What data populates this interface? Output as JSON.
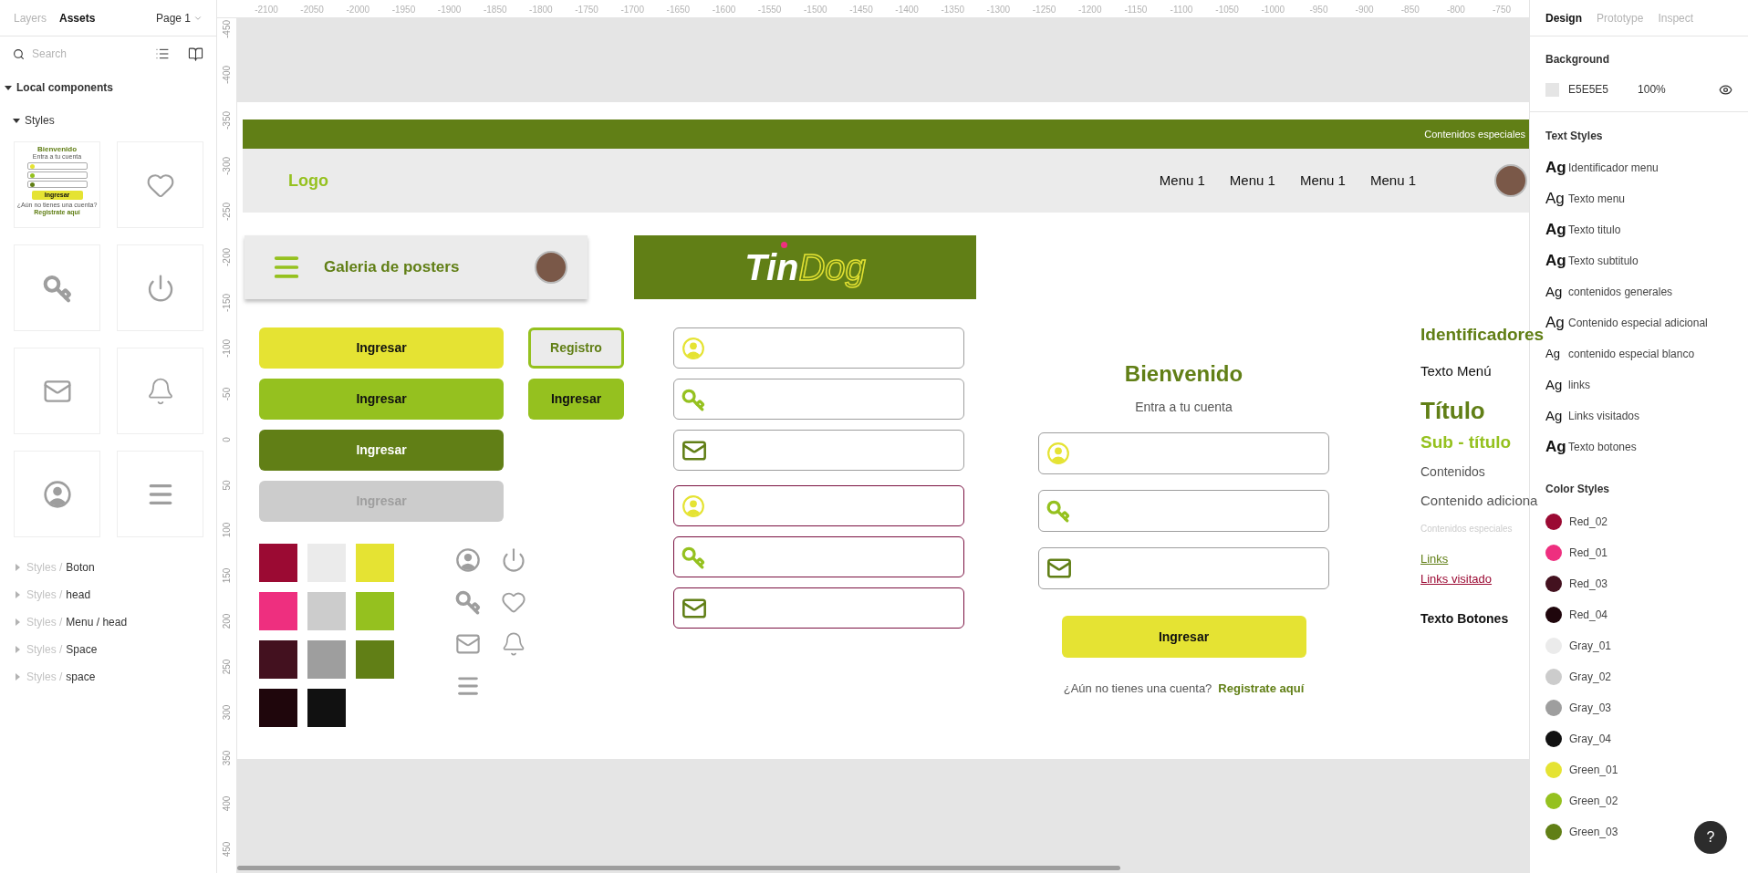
{
  "left_panel": {
    "tabs": [
      {
        "label": "Layers",
        "selected": false
      },
      {
        "label": "Assets",
        "selected": true
      }
    ],
    "page": "Page 1",
    "search": {
      "placeholder": "Search"
    },
    "section": {
      "label": "Local components",
      "expanded": true
    },
    "group": {
      "label": "Styles",
      "expanded": true
    },
    "thumbnail": {
      "title": "Bienvenido",
      "subtitle": "Entra a tu cuenta",
      "button": "Ingresar",
      "prompt": "¿Aún no tienes una cuenta?",
      "link": "Registrate aquí"
    },
    "tree": [
      {
        "prefix": "Styles /",
        "label": "Boton",
        "expanded": false
      },
      {
        "prefix": "Styles /",
        "label": "head",
        "expanded": false
      },
      {
        "prefix": "Styles /",
        "label": "Menu / head",
        "expanded": false
      },
      {
        "prefix": "Styles /",
        "label": "Space",
        "expanded": false
      },
      {
        "prefix": "Styles /",
        "label": "space",
        "expanded": false
      }
    ]
  },
  "rulers": {
    "horizontal": [
      "-2100",
      "-2050",
      "-2000",
      "-1950",
      "-1900",
      "-1850",
      "-1800",
      "-1750",
      "-1700",
      "-1650",
      "-1600",
      "-1550",
      "-1500",
      "-1450",
      "-1400",
      "-1350",
      "-1300",
      "-1250",
      "-1200",
      "-1150",
      "-1100",
      "-1050",
      "-1000",
      "-950",
      "-900",
      "-850",
      "-800",
      "-750"
    ],
    "vertical": [
      "-450",
      "-400",
      "-350",
      "-300",
      "-250",
      "-200",
      "-150",
      "-100",
      "-50",
      "0",
      "50",
      "100",
      "150",
      "200",
      "250",
      "300",
      "350",
      "400",
      "450"
    ]
  },
  "canvas": {
    "banner": {
      "text": "Contenidos especiales"
    },
    "header": {
      "logo": "Logo",
      "menu": [
        "Menu 1",
        "Menu 1",
        "Menu 1",
        "Menu 1"
      ]
    },
    "app_bar": {
      "title": "Galeria de posters"
    },
    "brand": {
      "solid": "Tin",
      "outline": "Dog"
    },
    "buttons": [
      {
        "label": "Ingresar",
        "kind": "primary"
      },
      {
        "label": "Ingresar",
        "kind": "secondary"
      },
      {
        "label": "Ingresar",
        "kind": "dark"
      },
      {
        "label": "Ingresar",
        "kind": "disabled"
      }
    ],
    "side_buttons": [
      {
        "label": "Registro",
        "kind": "outline"
      },
      {
        "label": "Ingresar",
        "kind": "secondary"
      }
    ],
    "swatches": [
      {
        "color": "#9b0a33"
      },
      {
        "color": "#ebebeb"
      },
      {
        "color": "#e5e333"
      },
      {
        "color": "#ee2f7f"
      },
      {
        "color": "#cccccc"
      },
      {
        "color": "#95c11f"
      },
      {
        "color": "#43111f"
      },
      {
        "color": "#9e9e9e"
      },
      {
        "color": "#617f16"
      },
      {
        "color": "#1f060c"
      },
      {
        "color": "#111111"
      }
    ],
    "inputs": [
      {
        "kind": "default"
      },
      {
        "kind": "default"
      },
      {
        "kind": "default"
      },
      {
        "kind": "error"
      },
      {
        "kind": "error"
      },
      {
        "kind": "error"
      }
    ],
    "login": {
      "title": "Bienvenido",
      "subtitle": "Entra a tu cuenta",
      "fields": [
        {
          "kind": "default"
        },
        {
          "kind": "default"
        },
        {
          "kind": "default"
        }
      ],
      "button": "Ingresar",
      "prompt": "¿Aún no tienes una cuenta?",
      "link": "Registrate aquí"
    },
    "type_samples": [
      {
        "text": "Identificadores",
        "kind": "identifier"
      },
      {
        "text": "Texto Menú",
        "kind": "menu"
      },
      {
        "text": "Título",
        "kind": "title"
      },
      {
        "text": "Sub - título",
        "kind": "subtitle"
      },
      {
        "text": "Contenidos",
        "kind": "content"
      },
      {
        "text": "Contenido adiciona",
        "kind": "extra"
      },
      {
        "text": "Contenidos especiales",
        "kind": "special"
      },
      {
        "text": "Links",
        "kind": "link"
      },
      {
        "text": "Links visitado",
        "kind": "visited"
      },
      {
        "text": "Texto Botones",
        "kind": "button"
      }
    ]
  },
  "right_panel": {
    "tabs": [
      {
        "label": "Design",
        "selected": true
      },
      {
        "label": "Prototype",
        "selected": false
      },
      {
        "label": "Inspect",
        "selected": false
      }
    ],
    "background": {
      "label": "Background",
      "hex": "E5E5E5",
      "opacity": "100%",
      "visible": true,
      "color": "#e5e5e5"
    },
    "text_styles": {
      "title": "Text Styles",
      "items": [
        {
          "sample": "Ag",
          "name": "Identificador menu",
          "kind": "bold"
        },
        {
          "sample": "Ag",
          "name": "Texto menu",
          "kind": "regular"
        },
        {
          "sample": "Ag",
          "name": "Texto titulo",
          "kind": "bold"
        },
        {
          "sample": "Ag",
          "name": "Texto subtitulo",
          "kind": "bold"
        },
        {
          "sample": "Ag",
          "name": "contenidos generales",
          "kind": "medium"
        },
        {
          "sample": "Ag",
          "name": "Contenido especial adicional",
          "kind": "regular"
        },
        {
          "sample": "Ag",
          "name": "contenido especial blanco",
          "kind": "small"
        },
        {
          "sample": "Ag",
          "name": "links",
          "kind": "medium"
        },
        {
          "sample": "Ag",
          "name": "Links visitados",
          "kind": "medium"
        },
        {
          "sample": "Ag",
          "name": "Texto botones",
          "kind": "bold"
        }
      ]
    },
    "color_styles": {
      "title": "Color Styles",
      "items": [
        {
          "name": "Red_02",
          "color": "#9b0a33"
        },
        {
          "name": "Red_01",
          "color": "#ee2f7f"
        },
        {
          "name": "Red_03",
          "color": "#43111f"
        },
        {
          "name": "Red_04",
          "color": "#1f060c"
        },
        {
          "name": "Gray_01",
          "color": "#ebebeb"
        },
        {
          "name": "Gray_02",
          "color": "#cccccc"
        },
        {
          "name": "Gray_03",
          "color": "#9e9e9e"
        },
        {
          "name": "Gray_04",
          "color": "#111111"
        },
        {
          "name": "Green_01",
          "color": "#e5e333"
        },
        {
          "name": "Green_02",
          "color": "#95c11f"
        },
        {
          "name": "Green_03",
          "color": "#617f16"
        }
      ]
    }
  },
  "help": {
    "label": "?"
  }
}
